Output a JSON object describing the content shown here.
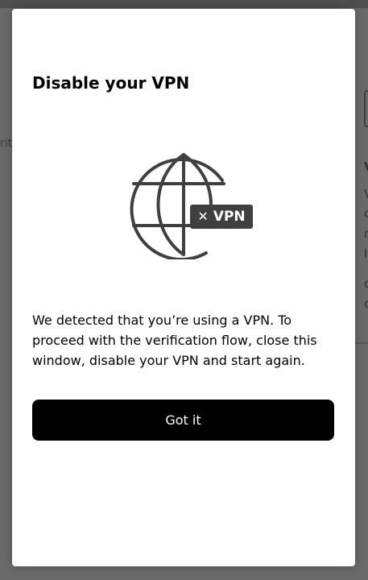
{
  "background": {
    "left_text": "rit",
    "right_letters": [
      "V",
      "V",
      "c",
      "n",
      "l",
      "c",
      "c"
    ]
  },
  "modal": {
    "title": "Disable your VPN",
    "illustration": {
      "icon": "globe-icon",
      "badge_icon": "close-icon",
      "badge_label": "VPN"
    },
    "message": "We detected that you’re using a VPN. To proceed with the verification flow, close this window, disable your VPN and start again.",
    "button_label": "Got it"
  },
  "colors": {
    "overlay": "#6a6a6a",
    "modal_bg": "#ffffff",
    "icon_dark": "#3f3f3f",
    "button_bg": "#000000",
    "button_text": "#ffffff"
  }
}
